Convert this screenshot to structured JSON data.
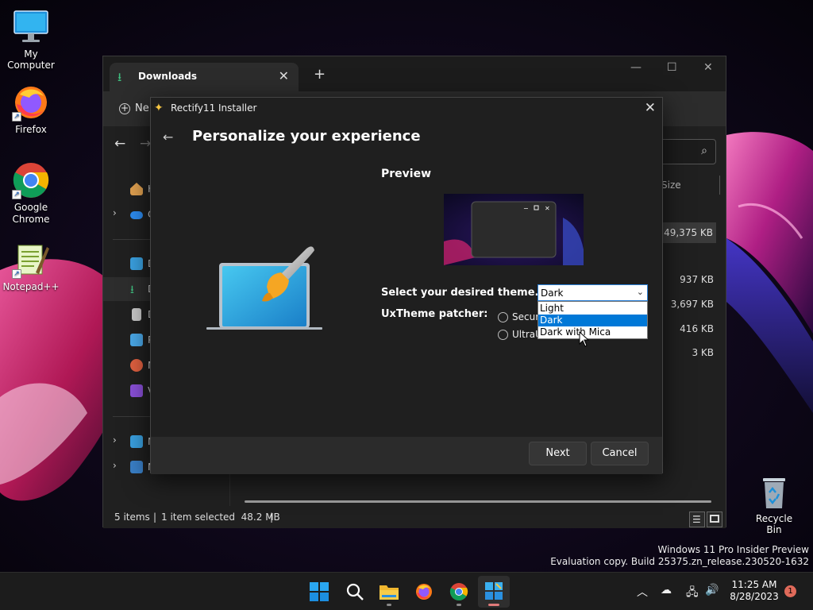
{
  "desktop": {
    "icons": [
      {
        "label": "My Computer",
        "icon": "monitor-icon"
      },
      {
        "label": "Firefox",
        "icon": "firefox-icon"
      },
      {
        "label": "Google\nChrome",
        "icon": "chrome-icon"
      },
      {
        "label": "Notepad++",
        "icon": "notepadpp-icon"
      }
    ],
    "recycle_bin": "Recycle Bin"
  },
  "explorer": {
    "tab_title": "Downloads",
    "new_tab": "+",
    "toolbar_new": "Ne",
    "search_icon": "search-icon",
    "column_size": "Size",
    "sidebar_letters": [
      "H",
      "C",
      "D",
      "D",
      "D",
      "P",
      "M",
      "V",
      "M",
      "N"
    ],
    "sizes": [
      "49,375 KB",
      "937 KB",
      "3,697 KB",
      "416 KB",
      "3 KB"
    ],
    "status": {
      "items": "5 items",
      "sep": "|",
      "selected": "1 item selected  48.2 MB",
      "sep2": "|"
    }
  },
  "installer": {
    "title": "Rectify11 Installer",
    "heading": "Personalize your experience",
    "preview_label": "Preview",
    "theme_label": "Select your desired theme.",
    "uxtheme_label": "UxTheme patcher:",
    "radio_options": [
      "Secur",
      "UltraU"
    ],
    "theme_select": {
      "value": "Dark",
      "options": [
        "Light",
        "Dark",
        "Dark with Mica"
      ],
      "highlighted": "Dark"
    },
    "next_button": "Next",
    "cancel_button": "Cancel"
  },
  "watermark": {
    "line1": "Windows 11 Pro Insider Preview",
    "line2": "Evaluation copy. Build 25375.zn_release.230520-1632"
  },
  "taskbar": {
    "apps": [
      "start-icon",
      "search-icon",
      "file-explorer-icon",
      "firefox-icon",
      "chrome-icon",
      "rectify11-icon"
    ],
    "time": "11:25 AM",
    "date": "8/28/2023",
    "notification_count": "1"
  },
  "colors": {
    "accent": "#0078d7",
    "dialog_bg": "#1f1f1f",
    "footer_bg": "#2b2b2b"
  }
}
